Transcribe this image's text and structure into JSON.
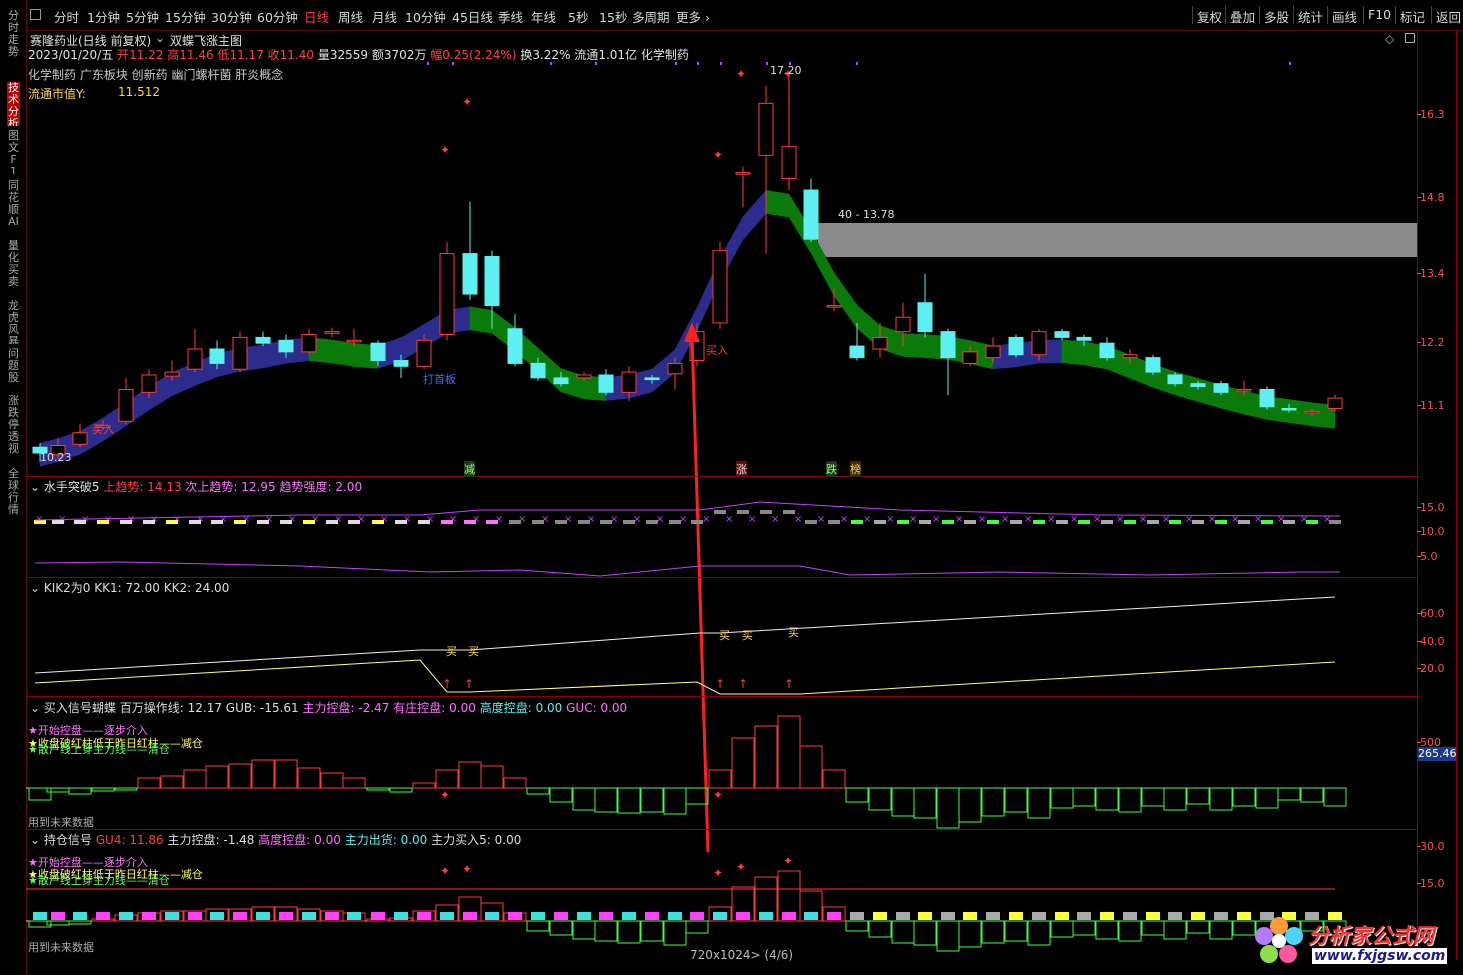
{
  "timeframes": [
    "分时",
    "1分钟",
    "5分钟",
    "15分钟",
    "30分钟",
    "60分钟",
    "日线",
    "周线",
    "月线",
    "10分钟",
    "45日线",
    "季线",
    "年线",
    "5秒",
    "15秒",
    "多周期",
    "更多 ›"
  ],
  "active_timeframe": "日线",
  "right_toolbar": [
    "复权",
    "叠加",
    "多股",
    "统计",
    "画线",
    "F10",
    "标记",
    "返回"
  ],
  "left_tabs": [
    "分时走势",
    "技术分析",
    "图文F10",
    "同花顺AI",
    "量化买卖",
    "龙虎风暴",
    "问题股",
    "涨跌停透视",
    "全球行情"
  ],
  "stock": {
    "title": "赛隆药业(日线 前复权)",
    "indicator_name": "双蝶飞涨主图",
    "date": "2023/01/20/五",
    "open_label": "开",
    "open": "11.22",
    "high_label": "高",
    "high": "11.46",
    "low_label": "低",
    "low": "11.17",
    "close_label": "收",
    "close": "11.40",
    "vol_label": "量",
    "vol": "32559",
    "amt_label": "额",
    "amt": "3702万",
    "chg_label": "幅",
    "chg": "0.25(2.24%)",
    "turnover_label": "换",
    "turnover": "3.22%",
    "float_label": "流通",
    "float": "1.01亿",
    "sector": "化学制药",
    "concepts": "化学制药 广东板块 创新药 幽门螺杆菌 肝炎概念",
    "mcap_label": "流通市值Y:",
    "mcap": "11.512"
  },
  "price_axis": [
    "16.3",
    "14.8",
    "13.4",
    "12.2",
    "11.1"
  ],
  "annotations": {
    "high_price": "17.20",
    "low_price": "10.23",
    "resistance": "40 - 13.78",
    "buy1": "买入",
    "buy2": "买入",
    "dazb": "打首板",
    "jian": "减",
    "zhang": "涨",
    "die": "跌",
    "bang": "榜"
  },
  "panel2": {
    "title": "水手突破5",
    "k1": "上趋势:",
    "v1": "14.13",
    "k2": "次上趋势:",
    "v2": "12.95",
    "k3": "趋势强度:",
    "v3": "2.00",
    "axis": [
      "15.0",
      "10.0",
      "5.0"
    ]
  },
  "panel3": {
    "title": "KIK2为0",
    "k1": "KK1:",
    "v1": "72.00",
    "k2": "KK2:",
    "v2": "24.00",
    "axis": [
      "60.0",
      "40.0",
      "20.0"
    ],
    "buy": "买"
  },
  "panel4": {
    "title": "买入信号蝴蝶",
    "k1": "百万操作线:",
    "v1": "12.17",
    "k2": "GUB:",
    "v2": "-15.61",
    "k3": "主力控盘:",
    "v3": "-2.47",
    "k4": "有庄控盘:",
    "v4": "0.00",
    "k5": "高度控盘:",
    "v5": "0.00",
    "k6": "GUC:",
    "v6": "0.00",
    "legend1": "★开始控盘——逐步介入",
    "legend2": "★收盘破红柱低于昨日红柱——减仓",
    "legend3": "★散户线上穿主力线——清仓",
    "future": "用到未来数据",
    "axis": [
      "500"
    ],
    "badge": "265.46"
  },
  "panel5": {
    "title": "持仓信号",
    "k1": "GU4:",
    "v1": "11.86",
    "k2": "主力控盘:",
    "v2": "-1.48",
    "k3": "高度控盘:",
    "v3": "0.00",
    "k4": "主力出货:",
    "v4": "0.00",
    "k5": "主力买入5:",
    "v5": "0.00",
    "legend1": "★开始控盘——逐步介入",
    "legend2": "★收盘破红柱低于昨日红柱——减仓",
    "legend3": "★散户线上穿主力线——清仓",
    "future": "用到未来数据",
    "axis": [
      "30.0",
      "15.0"
    ]
  },
  "footer": "720x1024> (4/6)",
  "watermark": {
    "brand": "分析家公式网",
    "url": "www.fxjgsw.com"
  },
  "colors": {
    "up": "#ff3b3b",
    "down": "#5ef0f0",
    "band_up": "#2c2c8c",
    "band_down": "#0a7a0a",
    "axis": "#8b0000"
  }
}
